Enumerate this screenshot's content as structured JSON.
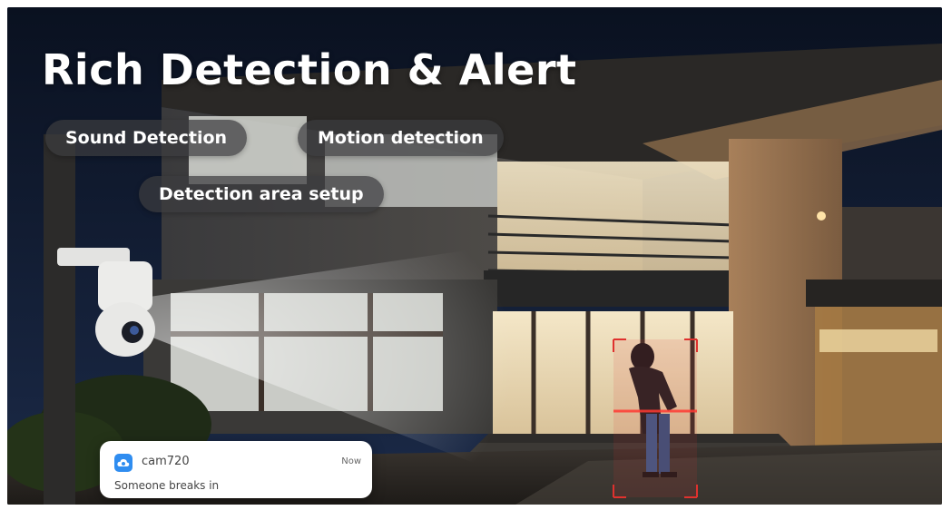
{
  "headline": "Rich Detection & Alert",
  "features": [
    "Sound Detection",
    "Motion detection",
    "Detection area setup"
  ],
  "notification": {
    "app_icon": "cloud-camera-icon",
    "app_name": "cam720",
    "time": "Now",
    "message": "Someone breaks in"
  },
  "colors": {
    "alert_red": "#e0322e",
    "app_icon_blue": "#2f8df0",
    "night_sky": "#0d1424"
  }
}
